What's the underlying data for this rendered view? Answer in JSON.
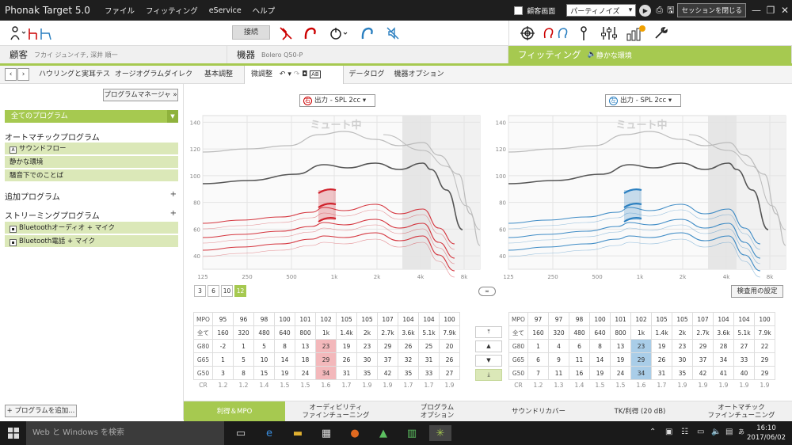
{
  "titlebar": {
    "app_name": "Phonak Target 5.0",
    "menus": [
      "ファイル",
      "フィッティング",
      "eService",
      "ヘルプ"
    ],
    "client_screen_label": "顧客画面",
    "noise_dropdown": "パーティノイズ",
    "close_session": "セッションを閉じる"
  },
  "toolbar": {
    "connect_label": "接続"
  },
  "header": {
    "client_label": "顧客",
    "client_name": "フカイ ジュンイチ, 深井 順一",
    "device_label": "機器",
    "device_name": "Bolero Q50-P",
    "fitting_label": "フィッティング",
    "fitting_env": "静かな環境"
  },
  "tabs": [
    "ハウリングと実耳テスト",
    "オージオグラムダイレクト",
    "基本調整",
    "微調整",
    "データログ",
    "機器オプション"
  ],
  "tabs_active_index": 3,
  "tab_ab": "AB",
  "left": {
    "program_manager": "プログラムマネージャ",
    "program_manager_arrow": "»",
    "all_programs": "全てのプログラム",
    "auto_title": "オートマチックプログラム",
    "auto_items": [
      "サウンドフロー",
      "静かな環境",
      "騒音下でのことば"
    ],
    "auto_item_icon": "A",
    "added_title": "追加プログラム",
    "streaming_title": "ストリーミングプログラム",
    "streaming_items": [
      "Bluetoothオーディオ + マイク",
      "Bluetooth電話 + マイク"
    ],
    "add_program": "+ プログラムを追加..."
  },
  "colors": {
    "accent": "#a6c950",
    "right_ear": "#d0202a",
    "left_ear": "#2a7fc0"
  },
  "charts": {
    "right_dropdown": "出力 - SPL 2cc",
    "left_dropdown": "出力 - SPL 2cc",
    "right_side": "右",
    "left_side": "左",
    "mute_label": "ミュート中",
    "y_ticks": [
      140,
      120,
      100,
      80,
      60,
      40
    ],
    "x_ticks": [
      "125",
      "250",
      "500",
      "1k",
      "2k",
      "4k",
      "8k"
    ]
  },
  "handles": {
    "options": [
      "3",
      "6",
      "10",
      "12"
    ],
    "selected": "12"
  },
  "test_settings": "検査用の設定",
  "mid_buttons": [
    "⤒",
    "▲",
    "▼",
    "⤓"
  ],
  "right_table": {
    "rows": [
      {
        "label": "MPO",
        "values": [
          "95",
          "96",
          "98",
          "100",
          "101",
          "102",
          "105",
          "105",
          "107",
          "104",
          "104",
          "100"
        ]
      },
      {
        "label": "全て",
        "values": [
          "160",
          "320",
          "480",
          "640",
          "800",
          "1k",
          "1.4k",
          "2k",
          "2.7k",
          "3.6k",
          "5.1k",
          "7.9k"
        ]
      },
      {
        "label": "G80",
        "values": [
          "-2",
          "1",
          "5",
          "8",
          "13",
          "23",
          "19",
          "23",
          "29",
          "26",
          "25",
          "20"
        ]
      },
      {
        "label": "G65",
        "values": [
          "1",
          "5",
          "10",
          "14",
          "18",
          "29",
          "26",
          "30",
          "37",
          "32",
          "31",
          "26"
        ]
      },
      {
        "label": "G50",
        "values": [
          "3",
          "8",
          "15",
          "19",
          "24",
          "34",
          "31",
          "35",
          "42",
          "35",
          "33",
          "27"
        ]
      }
    ],
    "cr_label": "CR",
    "cr": [
      "1.2",
      "1.2",
      "1.4",
      "1.5",
      "1.5",
      "1.6",
      "1.7",
      "1.9",
      "1.9",
      "1.7",
      "1.7",
      "1.9"
    ]
  },
  "left_table": {
    "rows": [
      {
        "label": "MPO",
        "values": [
          "97",
          "97",
          "98",
          "100",
          "101",
          "102",
          "105",
          "105",
          "107",
          "104",
          "104",
          "100"
        ]
      },
      {
        "label": "全て",
        "values": [
          "160",
          "320",
          "480",
          "640",
          "800",
          "1k",
          "1.4k",
          "2k",
          "2.7k",
          "3.6k",
          "5.1k",
          "7.9k"
        ]
      },
      {
        "label": "G80",
        "values": [
          "1",
          "4",
          "6",
          "8",
          "13",
          "23",
          "19",
          "23",
          "29",
          "28",
          "27",
          "22"
        ]
      },
      {
        "label": "G65",
        "values": [
          "6",
          "9",
          "11",
          "14",
          "19",
          "29",
          "26",
          "30",
          "37",
          "34",
          "33",
          "29"
        ]
      },
      {
        "label": "G50",
        "values": [
          "7",
          "11",
          "16",
          "19",
          "24",
          "34",
          "31",
          "35",
          "42",
          "41",
          "40",
          "29"
        ]
      }
    ],
    "cr_label": "CR",
    "cr": [
      "1.2",
      "1.3",
      "1.4",
      "1.5",
      "1.5",
      "1.6",
      "1.7",
      "1.9",
      "1.9",
      "1.9",
      "1.9",
      "1.9"
    ]
  },
  "bottom_tabs": [
    [
      "利得＆MPO",
      ""
    ],
    [
      "オーディビリティ",
      "ファインチューニング"
    ],
    [
      "プログラム",
      "オプション"
    ],
    [
      "サウンドリカバー",
      ""
    ],
    [
      "TK/利得 (20 dB)",
      ""
    ],
    [
      "オートマチック",
      "ファインチューニング"
    ]
  ],
  "taskbar": {
    "search_placeholder": "Web と Windows を検索",
    "time": "16:10",
    "date": "2017/06/02"
  }
}
